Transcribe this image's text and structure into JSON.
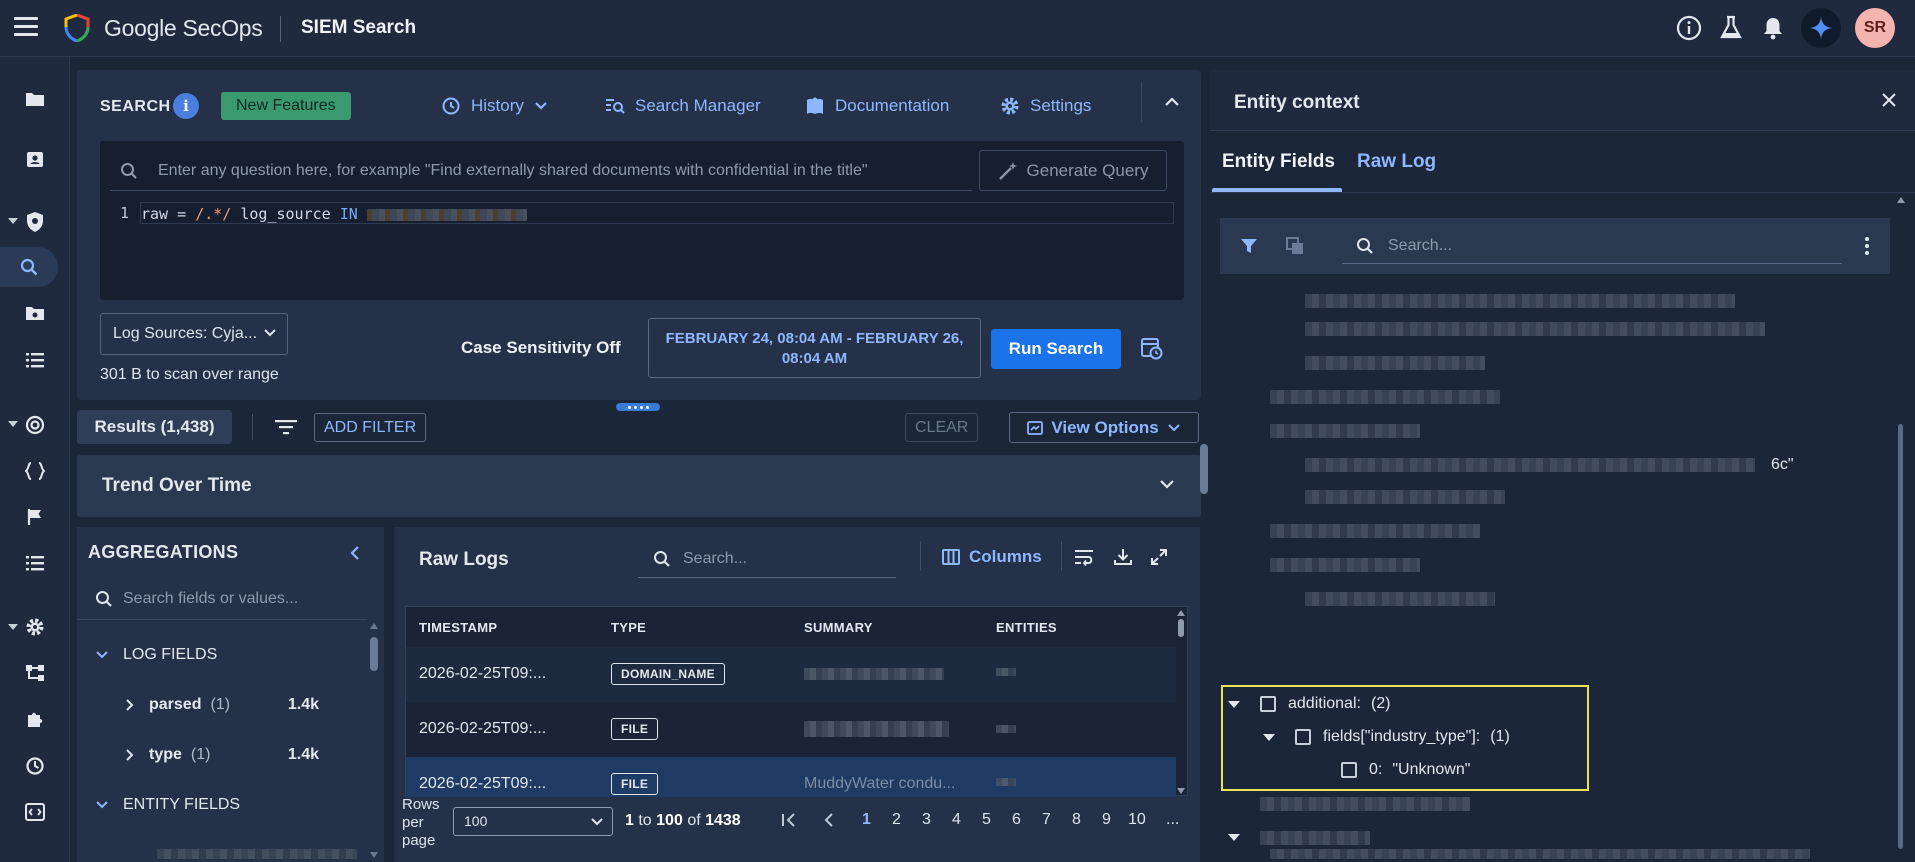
{
  "app": {
    "brand": "Google SecOps",
    "product": "SIEM Search",
    "user_initials": "SR"
  },
  "search": {
    "title": "SEARCH",
    "info_label": "i",
    "new_features": "New Features",
    "history": "History",
    "search_manager": "Search Manager",
    "documentation": "Documentation",
    "settings": "Settings",
    "nl_placeholder": "Enter any question here, for example \"Find externally shared documents with confidential in the title\"",
    "generate_query": "Generate Query",
    "line_number": "1",
    "code_prefix": "raw = ",
    "code_regex": "/.*/",
    "code_field": " log_source ",
    "code_keyword": "IN",
    "log_sources": "Log Sources: Cyja...",
    "scan_text": "301 B to scan over range",
    "case_sensitivity": "Case Sensitivity Off",
    "date_range": "FEBRUARY 24, 08:04 AM - FEBRUARY 26, 08:04 AM",
    "run_search": "Run Search"
  },
  "results": {
    "tab_label": "Results (1,438)",
    "add_filter": "ADD FILTER",
    "clear": "CLEAR",
    "view_options": "View Options"
  },
  "trend": {
    "title": "Trend Over Time"
  },
  "aggregations": {
    "title": "AGGREGATIONS",
    "search_placeholder": "Search fields or values...",
    "log_fields_label": "LOG FIELDS",
    "items": [
      {
        "name": "parsed",
        "count": "(1)",
        "value": "1.4k"
      },
      {
        "name": "type",
        "count": "(1)",
        "value": "1.4k"
      }
    ],
    "entity_fields_label": "ENTITY FIELDS"
  },
  "raw_logs": {
    "title": "Raw Logs",
    "search_placeholder": "Search...",
    "columns_label": "Columns",
    "headers": [
      "TIMESTAMP",
      "TYPE",
      "SUMMARY",
      "ENTITIES"
    ],
    "rows": [
      {
        "timestamp": "2026-02-25T09:...",
        "type": "DOMAIN_NAME",
        "summary": ""
      },
      {
        "timestamp": "2026-02-25T09:...",
        "type": "FILE",
        "summary": ""
      },
      {
        "timestamp": "2026-02-25T09:...",
        "type": "FILE",
        "summary": "MuddyWater condu..."
      }
    ],
    "pager": {
      "rows_label": "Rows per page",
      "rows_value": "100",
      "range_from": "1",
      "range_to_word": "to",
      "range_to": "100",
      "of_word": "of",
      "total": "1438",
      "pages": [
        "1",
        "2",
        "3",
        "4",
        "5",
        "6",
        "7",
        "8",
        "9",
        "10"
      ],
      "current_page": "1",
      "more": "..."
    }
  },
  "entity": {
    "title": "Entity context",
    "tabs": [
      "Entity Fields",
      "Raw Log"
    ],
    "search_placeholder": "Search...",
    "tail_text": "6c\"",
    "tree": {
      "additional_label": "additional:",
      "additional_count": "(2)",
      "fields_label": "fields[\"industry_type\"]:",
      "fields_count": "(1)",
      "value_index": "0:",
      "value": "\"Unknown\""
    }
  },
  "colors": {
    "accent": "#8fb7ff",
    "primary_button": "#1a73e8",
    "new_features_bg": "#3a9a6e",
    "highlight": "#e9e357"
  }
}
